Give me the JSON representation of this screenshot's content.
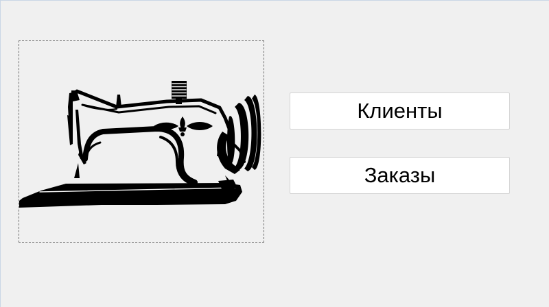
{
  "window": {
    "background": "#f0f0f0",
    "edge_color": "#c9d6e6"
  },
  "logo": {
    "icon": "sewing-machine-icon",
    "color": "#000000"
  },
  "buttons": {
    "clients_label": "Клиенты",
    "orders_label": "Заказы"
  }
}
